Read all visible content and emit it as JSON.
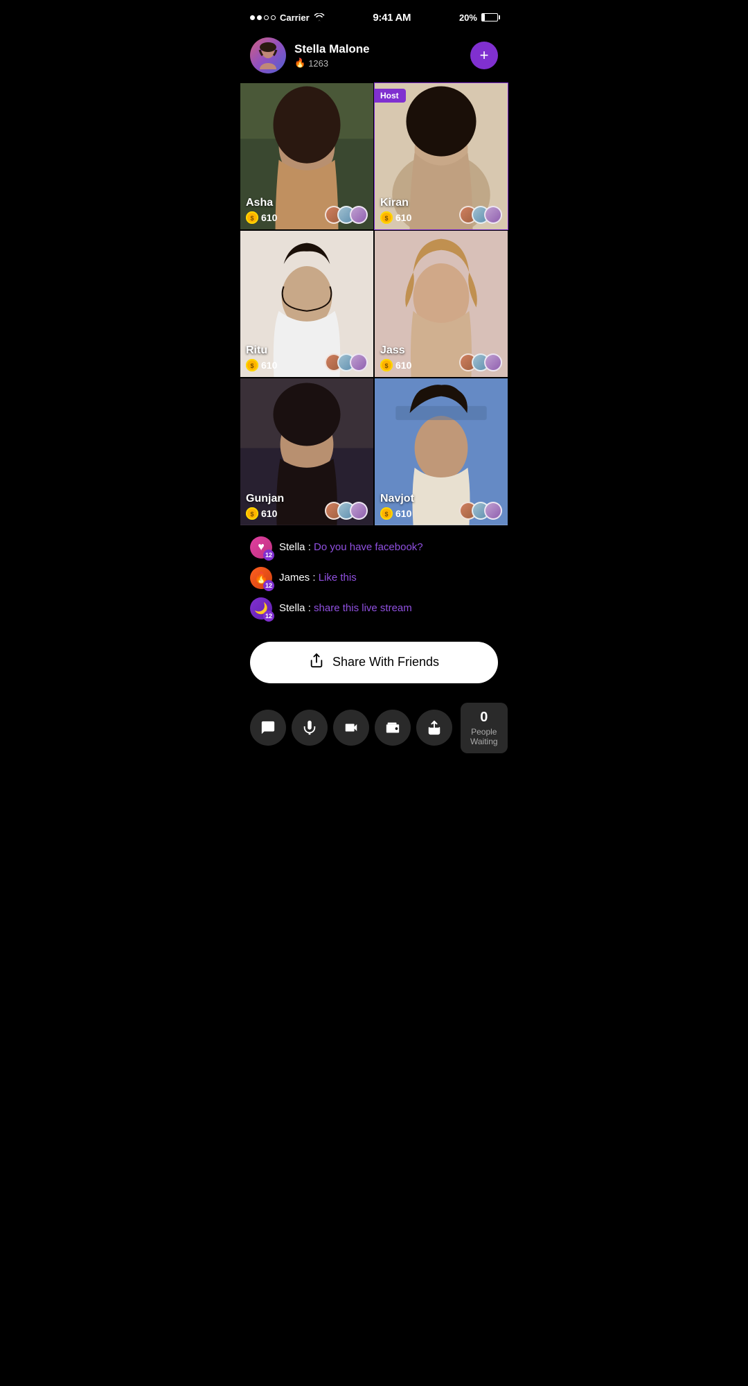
{
  "statusBar": {
    "carrier": "Carrier",
    "time": "9:41 AM",
    "battery": "20%",
    "signal": [
      true,
      true,
      false,
      false
    ]
  },
  "profile": {
    "name": "Stella Malone",
    "score": "1263",
    "addButtonLabel": "+",
    "flameIcon": "🔥"
  },
  "videoGrid": [
    {
      "id": "asha",
      "name": "Asha",
      "coins": "610",
      "isHost": false,
      "photoClass": "photo-asha"
    },
    {
      "id": "kiran",
      "name": "Kiran",
      "coins": "610",
      "isHost": true,
      "hostLabel": "Host",
      "photoClass": "photo-kiran"
    },
    {
      "id": "ritu",
      "name": "Ritu",
      "coins": "610",
      "isHost": false,
      "photoClass": "photo-ritu"
    },
    {
      "id": "jass",
      "name": "Jass",
      "coins": "610",
      "isHost": false,
      "photoClass": "photo-jass"
    },
    {
      "id": "gunjan",
      "name": "Gunjan",
      "coins": "610",
      "isHost": false,
      "photoClass": "photo-gunjan"
    },
    {
      "id": "navjot",
      "name": "Navjot",
      "coins": "610",
      "isHost": false,
      "photoClass": "photo-navjot"
    }
  ],
  "chatMessages": [
    {
      "id": 1,
      "sender": "Stella",
      "senderLabel": "Stella : ",
      "message": "Do you have facebook?",
      "badge": "12",
      "avatarType": "heart",
      "avatarIcon": "♥"
    },
    {
      "id": 2,
      "sender": "James",
      "senderLabel": "James : ",
      "message": "Like this",
      "badge": "12",
      "avatarType": "fire",
      "avatarIcon": "🔥"
    },
    {
      "id": 3,
      "sender": "Stella",
      "senderLabel": "Stella : ",
      "message": "share this live stream",
      "badge": "12",
      "avatarType": "moon",
      "avatarIcon": "🌙"
    }
  ],
  "shareButton": {
    "label": "Share With Friends",
    "icon": "share"
  },
  "bottomBar": {
    "buttons": [
      {
        "id": "chat",
        "icon": "chat",
        "label": "Chat"
      },
      {
        "id": "mic",
        "icon": "mic",
        "label": "Microphone"
      },
      {
        "id": "camera",
        "icon": "camera",
        "label": "Camera"
      },
      {
        "id": "wallet",
        "icon": "wallet",
        "label": "Wallet"
      },
      {
        "id": "share",
        "icon": "share",
        "label": "Share"
      }
    ],
    "peopleWaiting": {
      "count": "0",
      "label": "People Waiting"
    }
  },
  "colors": {
    "accent": "#8030d0",
    "background": "#000000",
    "chatMessageColor": "#9050e0",
    "coinColor": "#ffd700"
  }
}
